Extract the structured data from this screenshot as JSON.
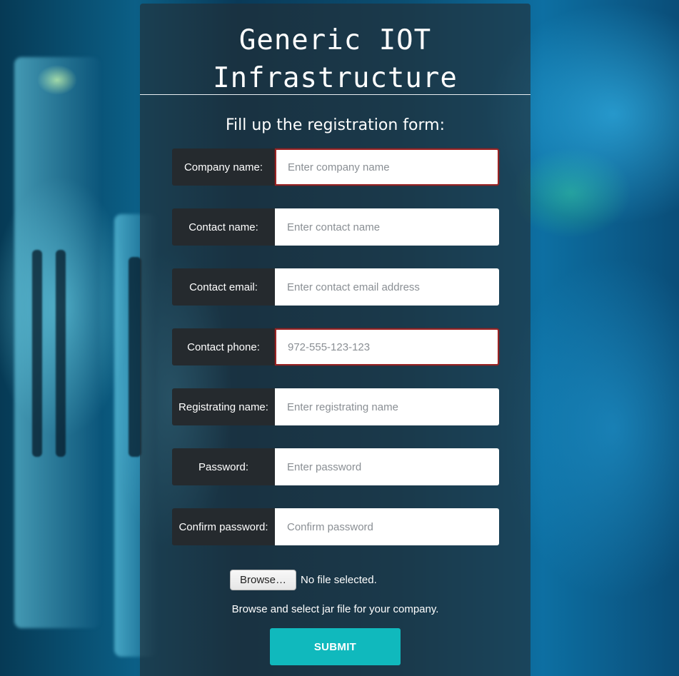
{
  "header": {
    "title_line1": "Generic IOT",
    "title_line2": "Infrastructure",
    "subtitle": "Fill up the registration form:"
  },
  "form": {
    "fields": [
      {
        "label": "Company name:",
        "placeholder": "Enter company name",
        "value": "",
        "invalid": true
      },
      {
        "label": "Contact name:",
        "placeholder": "Enter contact name",
        "value": "",
        "invalid": false
      },
      {
        "label": "Contact email:",
        "placeholder": "Enter contact email address",
        "value": "",
        "invalid": false
      },
      {
        "label": "Contact phone:",
        "placeholder": "972-555-123-123",
        "value": "",
        "invalid": true
      },
      {
        "label": "Registrating name:",
        "placeholder": "Enter registrating name",
        "value": "",
        "invalid": false
      },
      {
        "label": "Password:",
        "placeholder": "Enter password",
        "value": "",
        "invalid": false
      },
      {
        "label": "Confirm password:",
        "placeholder": "Confirm password",
        "value": "",
        "invalid": false
      }
    ],
    "file": {
      "browse_label": "Browse…",
      "status": "No file selected.",
      "help": "Browse and select jar file for your company."
    },
    "submit_label": "SUBMIT"
  },
  "colors": {
    "label_bg": "#252a2e",
    "submit_bg": "#10b9bd",
    "invalid_border": "#9a2323"
  }
}
